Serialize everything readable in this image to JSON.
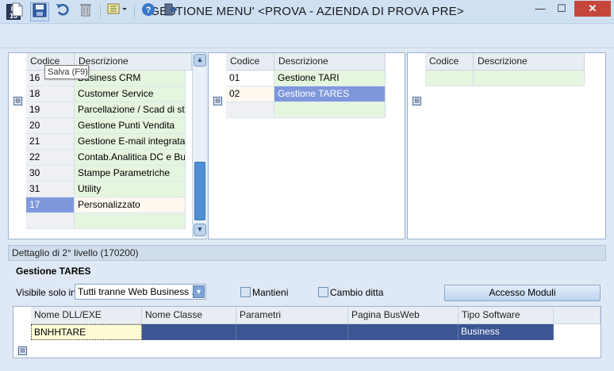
{
  "window": {
    "title": "GESTIONE MENU' <PROVA - AZIENDA DI PROVA PRE>",
    "app_icon_text": "B 15",
    "min_glyph": "—",
    "max_glyph": "☐",
    "close_glyph": "✕"
  },
  "toolbar": {
    "icons": [
      "new-document-icon",
      "save-icon",
      "undo-icon",
      "delete-icon",
      "list-dropdown-icon",
      "help-icon",
      "exit-icon"
    ],
    "tooltip": "Salva (F9)"
  },
  "panel1": {
    "headers": {
      "code": "Codice",
      "desc": "Descrizione"
    },
    "rows": [
      {
        "code": "16",
        "desc": "Business CRM"
      },
      {
        "code": "18",
        "desc": "Customer Service"
      },
      {
        "code": "19",
        "desc": "Parcellazione / Scad di st..."
      },
      {
        "code": "20",
        "desc": "Gestione Punti Vendita"
      },
      {
        "code": "21",
        "desc": "Gestione E-mail integrata"
      },
      {
        "code": "22",
        "desc": "Contab.Analitica DC e Bu..."
      },
      {
        "code": "30",
        "desc": "Stampe Parametriche"
      },
      {
        "code": "31",
        "desc": "Utility"
      },
      {
        "code": "17",
        "desc": "Personalizzato"
      },
      {
        "code": "",
        "desc": ""
      }
    ]
  },
  "panel2": {
    "headers": {
      "code": "Codice",
      "desc": "Descrizione"
    },
    "rows": [
      {
        "code": "01",
        "desc": "Gestione TARI"
      },
      {
        "code": "02",
        "desc": "Gestione TARES"
      },
      {
        "code": "",
        "desc": ""
      }
    ]
  },
  "panel3": {
    "headers": {
      "code": "Codice",
      "desc": "Descrizione"
    }
  },
  "detail": {
    "header": "Dettaglio di 2° livello (170200)",
    "title": "Gestione TARES",
    "visibile_label": "Visibile solo in",
    "visibile_value": "Tutti tranne Web Business ...",
    "mantieni_label": "Mantieni",
    "cambio_ditta_label": "Cambio ditta",
    "accesso_button": "Accesso Moduli",
    "grid_headers": [
      "Nome DLL/EXE",
      "Nome Classe",
      "Parametri",
      "Pagina BusWeb",
      "Tipo Software"
    ],
    "grid_row": [
      "BNHHTARE",
      "",
      "",
      "",
      "Business"
    ]
  },
  "colors": {
    "selected_row": "#3b5693",
    "selected_code": "#7f98dc",
    "green_cell": "#e5f5e0",
    "close_button": "#c7463b"
  }
}
